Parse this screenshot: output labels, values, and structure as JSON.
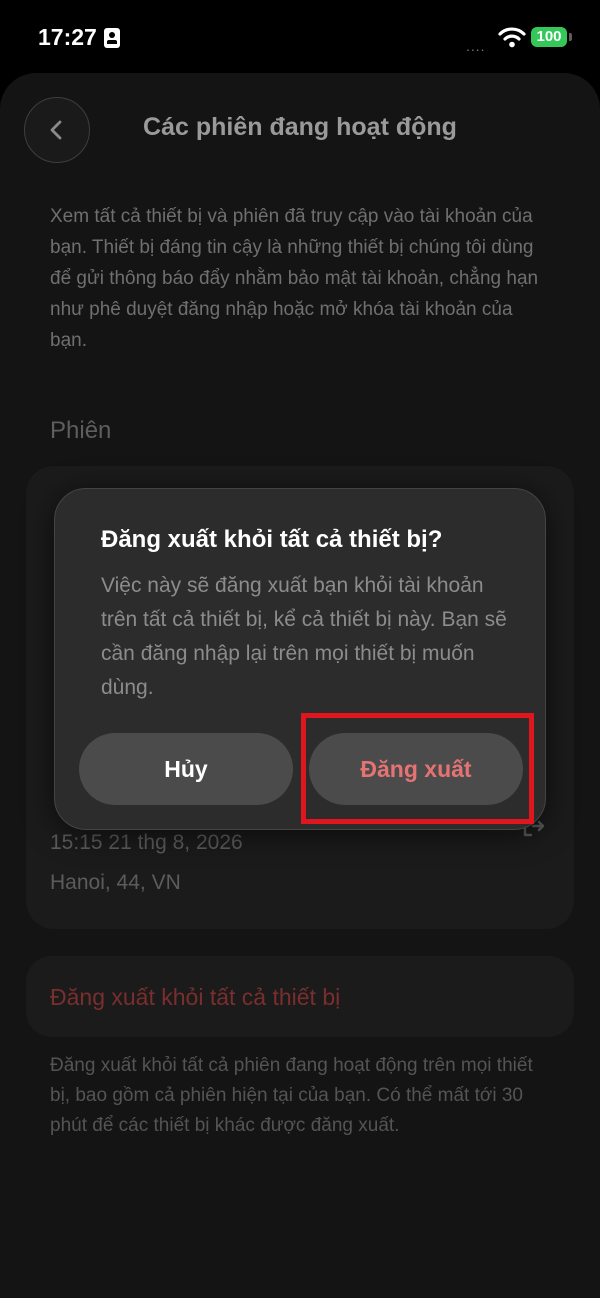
{
  "status_bar": {
    "time": "17:27",
    "battery": "100",
    "signal": "...."
  },
  "header": {
    "title": "Các phiên đang hoạt động"
  },
  "description": "Xem tất cả thiết bị và phiên đã truy cập vào tài khoản của bạn. Thiết bị đáng tin cậy là những thiết bị chúng tôi dùng để gửi thông báo đẩy nhằm bảo mật tài khoản, chẳng hạn như phê duyệt đăng nhập hoặc mở khóa tài khoản của bạn.",
  "sessions": {
    "section_label": "Phiên",
    "visible_session": {
      "time": "15:15 21 thg 8, 2026",
      "location": "Hanoi, 44, VN"
    }
  },
  "logout_all": {
    "label": "Đăng xuất khỏi tất cả thiết bị",
    "note": "Đăng xuất khỏi tất cả phiên đang hoạt động trên mọi thiết bị, bao gồm cả phiên hiện tại của bạn. Có thể mất tới 30 phút để các thiết bị khác được đăng xuất."
  },
  "dialog": {
    "title": "Đăng xuất khỏi tất cả thiết bị?",
    "message": "Việc này sẽ đăng xuất bạn khỏi tài khoản trên tất cả thiết bị, kể cả thiết bị này. Bạn sẽ cần đăng nhập lại trên mọi thiết bị muốn dùng.",
    "cancel_label": "Hủy",
    "confirm_label": "Đăng xuất"
  },
  "colors": {
    "battery": "#34c759",
    "destructive": "#e57373",
    "highlight": "#e0161f"
  },
  "icons": {
    "back": "chevron-left-icon",
    "session_action": "logout-arrow-icon",
    "wifi": "wifi-icon"
  }
}
